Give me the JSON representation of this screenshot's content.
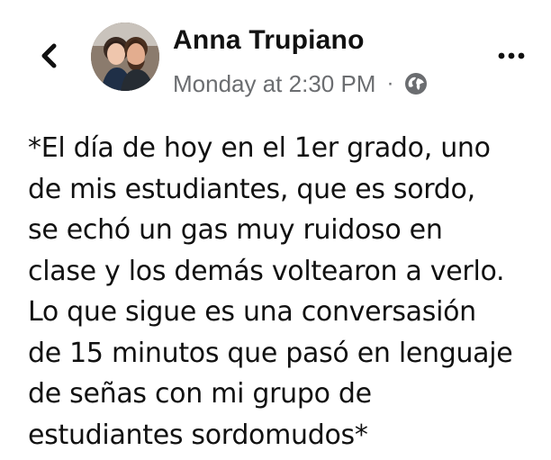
{
  "post": {
    "author_name": "Anna Trupiano",
    "timestamp": "Monday at 2:30 PM",
    "separator": "·",
    "audience_icon": "globe-icon",
    "back_icon": "chevron-left-icon",
    "more_icon": "more-horizontal-icon",
    "body_lines": [
      "*El día de hoy en el 1er grado, uno",
      "de mis estudiantes, que es sordo,",
      "se echó un gas muy ruidoso en",
      "clase y los demás voltearon a verlo.",
      "Lo que sigue es una conversasión",
      "de 15 minutos que pasó en lenguaje",
      "de señas con mi grupo de",
      "estudiantes sordomudos*"
    ]
  },
  "colors": {
    "text": "#111111",
    "secondary_text": "#6b6d70",
    "background": "#ffffff"
  }
}
